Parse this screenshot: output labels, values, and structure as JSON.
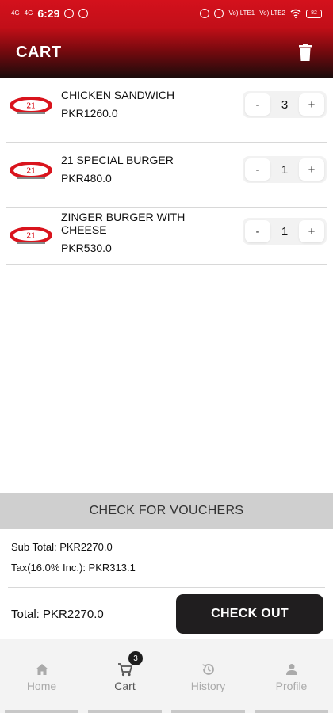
{
  "status_bar": {
    "network_left_1": "4G",
    "network_left_2": "4G",
    "time": "6:29",
    "network_right_1": "Vo) LTE1",
    "network_right_2": "Vo) LTE2",
    "battery": "82"
  },
  "header": {
    "title": "CART",
    "delete_icon": "trash-icon"
  },
  "cart": {
    "items": [
      {
        "name": "CHICKEN SANDWICH",
        "price": "PKR1260.0",
        "quantity": "3",
        "minus": "-",
        "plus": "+"
      },
      {
        "name": "21 SPECIAL BURGER",
        "price": "PKR480.0",
        "quantity": "1",
        "minus": "-",
        "plus": "+"
      },
      {
        "name": "ZINGER BURGER WITH CHEESE",
        "price": "PKR530.0",
        "quantity": "1",
        "minus": "-",
        "plus": "+"
      }
    ]
  },
  "vouchers": {
    "label": "CHECK FOR VOUCHERS"
  },
  "summary": {
    "subtotal": "Sub Total: PKR2270.0",
    "tax": "Tax(16.0% Inc.): PKR313.1",
    "total": "Total: PKR2270.0",
    "checkout_label": "CHECK OUT"
  },
  "nav": {
    "items": [
      {
        "label": "Home",
        "icon": "home-icon"
      },
      {
        "label": "Cart",
        "icon": "cart-icon",
        "badge": "3"
      },
      {
        "label": "History",
        "icon": "history-icon"
      },
      {
        "label": "Profile",
        "icon": "profile-icon"
      }
    ]
  },
  "colors": {
    "brand_red": "#c40f18",
    "dark": "#201e1f",
    "voucher_bg": "#cfcfcf"
  }
}
